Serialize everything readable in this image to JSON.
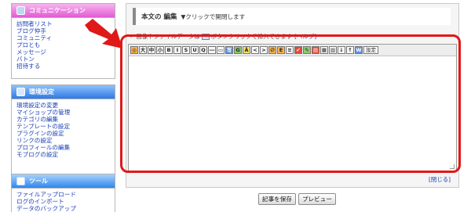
{
  "sidebar": {
    "communication": {
      "header": "コミュニケーション",
      "items": [
        "訪問者リスト",
        "ブログ仲手",
        "コミュニティ",
        "プロとも",
        "メッセージ",
        "バトン",
        "招待する"
      ]
    },
    "settings": {
      "header": "環境設定",
      "items": [
        "環境設定の変更",
        "マイショップの管理",
        "カテゴリの編集",
        "テンプレートの設定",
        "プラグインの設定",
        "リンクの設定",
        "プロフィールの編集",
        "モブログの設定"
      ]
    },
    "tools": {
      "header": "ツール",
      "items": [
        "ファイルアップロード",
        "ログのインポート",
        "データのバックアップ"
      ]
    }
  },
  "editor": {
    "title": "本文の 編集",
    "toggle_hint": "▼クリックで開閉します",
    "note_prefix": "画像やファイルデータは",
    "note_suffix": "ボタンクリックで挿入できます",
    "help_link": "[ヘルプ]",
    "body_value": "",
    "toolbar": [
      "大",
      "中",
      "小",
      "B",
      "I",
      "S",
      "U",
      "Q",
      "―",
      "▭",
      "写",
      "G",
      "Ä",
      "<",
      ">",
      "∅",
      "E",
      "≡",
      "✔",
      "✎",
      "▤",
      "▦",
      "▥",
      "↓",
      "↑",
      "W",
      "設定"
    ],
    "close_link": "[閉じる]"
  },
  "buttons": {
    "save": "記事を保存",
    "preview": "プレビュー"
  },
  "colors": {
    "highlight": "#e01818",
    "link": "#1a3fb5",
    "comm_header": "#e35ad4",
    "settings_header": "#2f79e6",
    "tools_header": "#2f86ee"
  }
}
